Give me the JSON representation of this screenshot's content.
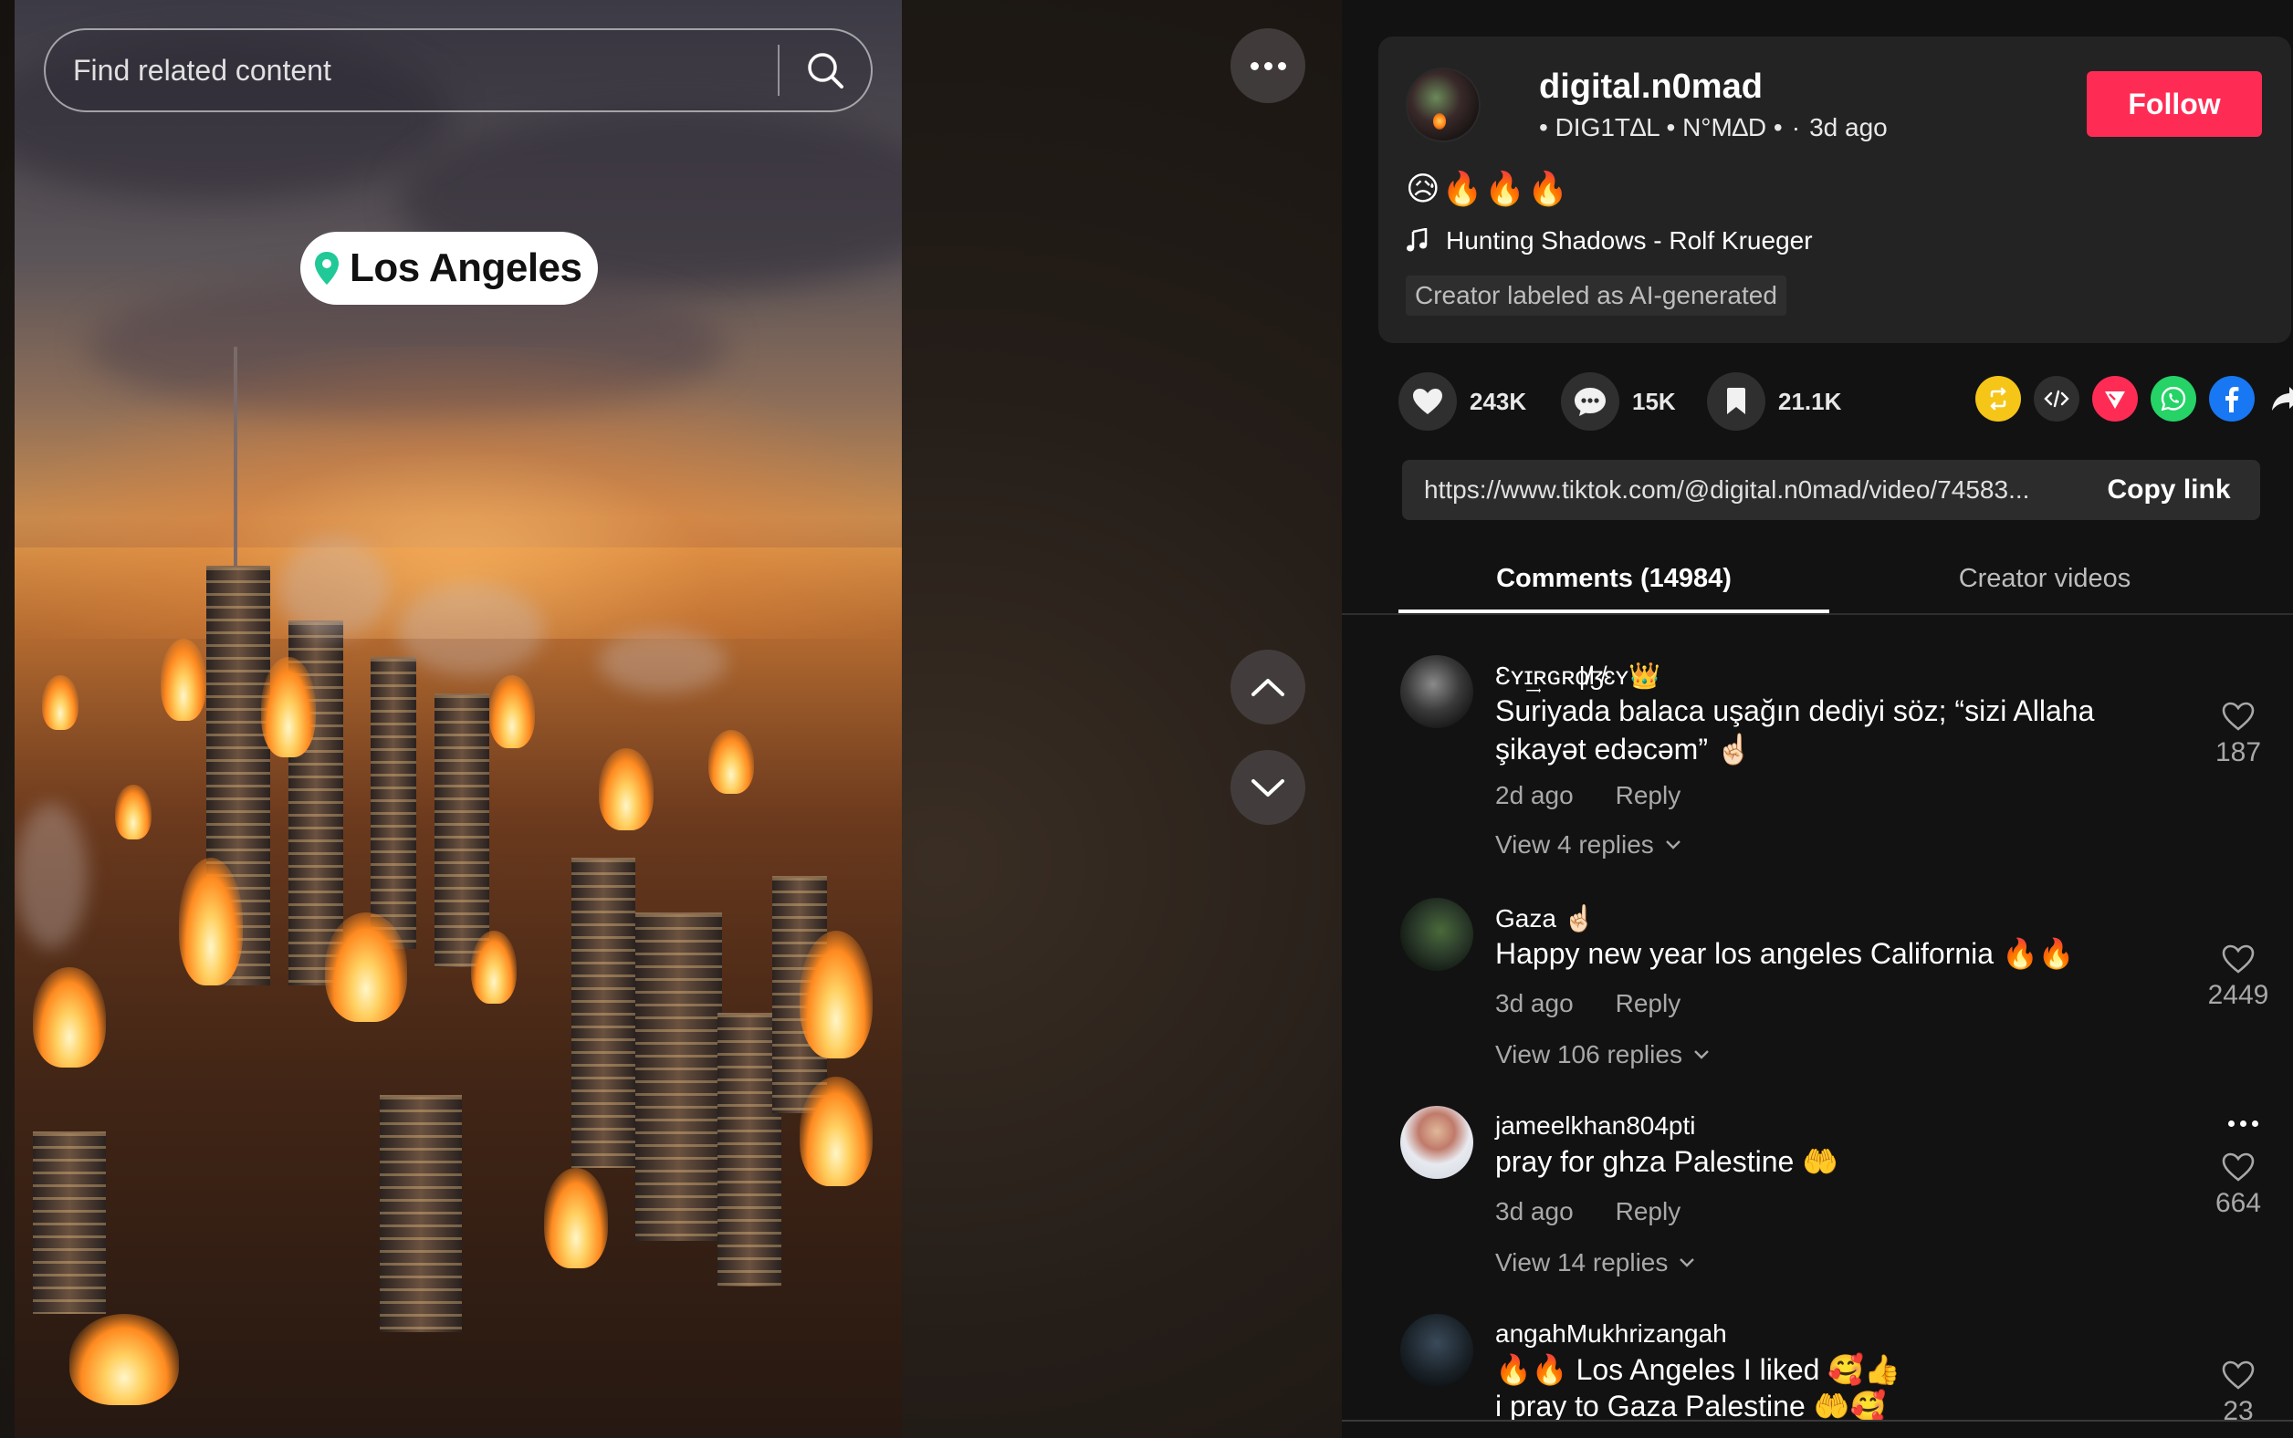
{
  "search": {
    "placeholder": "Find related content"
  },
  "video": {
    "location": "Los Angeles",
    "more_icon": "more-horizontal-icon",
    "nav_up_icon": "chevron-up-icon",
    "nav_down_icon": "chevron-down-icon"
  },
  "author": {
    "username": "digital.n0mad",
    "display_name": "• DIG1T∆L • N°M∆D •",
    "separator": "·",
    "posted": "3d ago",
    "follow_label": "Follow"
  },
  "caption": {
    "emojis": "😥🔥🔥🔥",
    "music": "Hunting Shadows - Rolf Krueger",
    "ai_label": "Creator labeled as AI-generated"
  },
  "stats": {
    "likes": "243K",
    "comments": "15K",
    "saves": "21.1K"
  },
  "share_targets": [
    "repost",
    "embed",
    "send",
    "whatsapp",
    "facebook",
    "share"
  ],
  "link": {
    "url": "https://www.tiktok.com/@digital.n0mad/video/74583...",
    "copy_label": "Copy link"
  },
  "tabs": {
    "comments_label": "Comments (14984)",
    "creator_videos_label": "Creator videos"
  },
  "comments": [
    {
      "user": "Ɛʏɪ͢ʀɢʀɸ̸ɮ̸ɛʏ👑",
      "text": "Suriyada balaca uşağın dediyi söz; “sizi Allaha şikayət edəcəm” ☝🏻",
      "time": "2d ago",
      "reply_label": "Reply",
      "replies": "View 4 replies",
      "likes": "187"
    },
    {
      "user": "Gaza ☝🏻",
      "text": "Happy new year los angeles California 🔥🔥",
      "time": "3d ago",
      "reply_label": "Reply",
      "replies": "View 106 replies",
      "likes": "2449"
    },
    {
      "user": "jameelkhan804pti",
      "text": "pray for ghza Palestine 🤲",
      "time": "3d ago",
      "reply_label": "Reply",
      "replies": "View 14 replies",
      "likes": "664"
    },
    {
      "user": "angahMukhrizangah",
      "text": "🔥🔥 Los Angeles I liked 🥰👍",
      "text2": "i pray to Gaza Palestine 🤲🥰",
      "likes": "23"
    }
  ],
  "colors": {
    "follow": "#fe2c55",
    "panel": "#121212",
    "card": "#232323",
    "repost": "#f5c518",
    "send": "#fe2c55",
    "whatsapp": "#25d366",
    "facebook": "#1877f2"
  }
}
